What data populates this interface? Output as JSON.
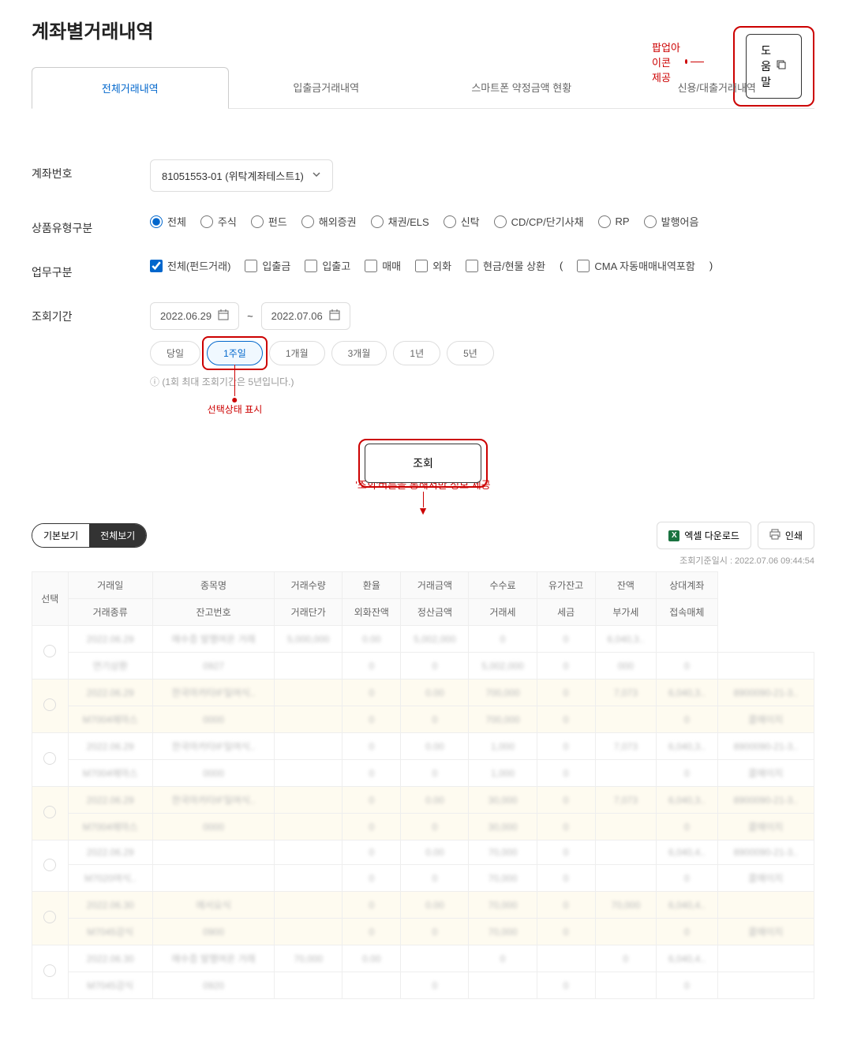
{
  "header": {
    "title": "계좌별거래내역",
    "help_label": "도움말",
    "popup_annotation": "팝업아이콘 제공"
  },
  "tabs": [
    {
      "label": "전체거래내역",
      "active": true
    },
    {
      "label": "입출금거래내역",
      "active": false
    },
    {
      "label": "스마트폰 약정금액 현황",
      "active": false
    },
    {
      "label": "신용/대출거래내역",
      "active": false
    }
  ],
  "form": {
    "account": {
      "label": "계좌번호",
      "value": "81051553-01 (위탁계좌테스트1)"
    },
    "product_type": {
      "label": "상품유형구분",
      "options": [
        "전체",
        "주식",
        "펀드",
        "해외증권",
        "채권/ELS",
        "신탁",
        "CD/CP/단기사채",
        "RP",
        "발행어음"
      ],
      "selected": "전체"
    },
    "biz_type": {
      "label": "업무구분",
      "options": [
        "전체(펀드거래)",
        "입출금",
        "입출고",
        "매매",
        "외화",
        "현금/현물 상환"
      ],
      "cma_option": "CMA 자동매매내역포함",
      "paren_open": "(",
      "paren_close": ")",
      "checked": [
        "전체(펀드거래)"
      ]
    },
    "period": {
      "label": "조회기간",
      "date_from": "2022.06.29",
      "date_sep": "~",
      "date_to": "2022.07.06",
      "buttons": [
        "당일",
        "1주일",
        "1개월",
        "3개월",
        "1년",
        "5년"
      ],
      "selected": "1주일",
      "note": "ⓘ (1회 최대 조회기간은 5년입니다.)",
      "annotation": "선택상태 표시"
    },
    "query_button": "조회",
    "query_annotation": "'조회'버튼을 통해서만 정보 제공"
  },
  "view": {
    "basic": "기본보기",
    "full": "전체보기",
    "excel": "엑셀 다운로드",
    "print": "인쇄",
    "timestamp": "조회기준일시 : 2022.07.06 09:44:54"
  },
  "table": {
    "headers_row1": [
      "선택",
      "거래일",
      "종목명",
      "거래수량",
      "환율",
      "거래금액",
      "수수료",
      "유가잔고",
      "잔액",
      "상대계좌"
    ],
    "headers_row2": [
      "거래종류",
      "잔고번호",
      "거래단가",
      "외화잔액",
      "정산금액",
      "거래세",
      "세금",
      "부가세",
      "접속매체"
    ],
    "rows": [
      {
        "c": [
          "2022.06.29",
          "매수증 발행여온 거래",
          "5,000,000",
          "0.00",
          "5,002,000",
          "0",
          "0",
          "6,040,3..",
          ""
        ]
      },
      {
        "c": [
          "연기상환",
          "0927",
          "",
          "0",
          "0",
          "5,002,000",
          "0",
          "000",
          "0",
          ""
        ]
      },
      {
        "c": [
          "2022.06.29",
          "한국마카타IF일여식..",
          "",
          "0",
          "0.00",
          "700,000",
          "0",
          "7,073",
          "6,040,3..",
          "8900090-21-3.."
        ]
      },
      {
        "c": [
          "M7004에마스",
          "0000",
          "",
          "0",
          "0",
          "700,000",
          "0",
          "",
          "0",
          "콜매이지"
        ]
      },
      {
        "c": [
          "2022.06.29",
          "한국마카타IF일여식..",
          "",
          "0",
          "0.00",
          "1,000",
          "0",
          "7,073",
          "6,040,3..",
          "8900090-21-3.."
        ]
      },
      {
        "c": [
          "M7004에마스",
          "0000",
          "",
          "0",
          "0",
          "1,000",
          "0",
          "",
          "0",
          "콜매이지"
        ]
      },
      {
        "c": [
          "2022.06.29",
          "한국마카타IF일여식..",
          "",
          "0",
          "0.00",
          "30,000",
          "0",
          "7,073",
          "6,040,3..",
          "8900090-21-3.."
        ]
      },
      {
        "c": [
          "M7004에마스",
          "0000",
          "",
          "0",
          "0",
          "30,000",
          "0",
          "",
          "0",
          "콜매이지"
        ]
      },
      {
        "c": [
          "2022.06.29",
          "",
          "",
          "0",
          "0.00",
          "70,000",
          "0",
          "",
          "6,040,4..",
          "8900090-21-3.."
        ]
      },
      {
        "c": [
          "M7020여식..",
          "",
          "",
          "0",
          "0",
          "70,000",
          "0",
          "",
          "0",
          "콜매이지"
        ]
      },
      {
        "c": [
          "2022.06.30",
          "에서요식",
          "",
          "0",
          "0.00",
          "70,000",
          "0",
          "70,000",
          "6,040,4..",
          ""
        ]
      },
      {
        "c": [
          "M7045강식",
          "0900",
          "",
          "0",
          "0",
          "70,000",
          "0",
          "",
          "0",
          "콜매이지"
        ]
      },
      {
        "c": [
          "2022.06.30",
          "매수증 발행여온 거래",
          "70,000",
          "0.00",
          "",
          "0",
          "",
          "0",
          "6,040,4..",
          ""
        ]
      },
      {
        "c": [
          "M7045강식",
          "0920",
          "",
          "",
          "0",
          "",
          "0",
          "",
          "0",
          ""
        ]
      }
    ]
  }
}
